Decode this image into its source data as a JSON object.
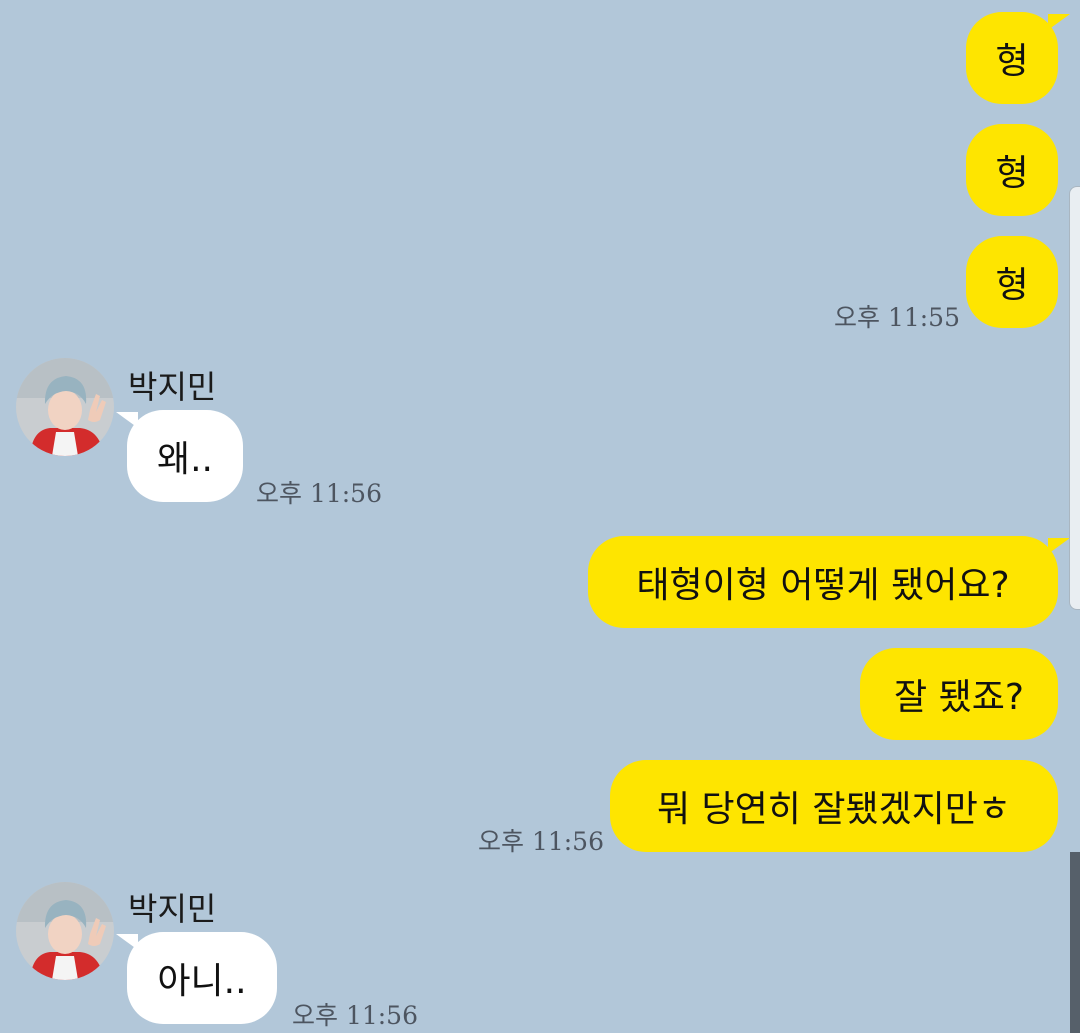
{
  "messages": {
    "m1": {
      "text": "형"
    },
    "m2": {
      "text": "형"
    },
    "m3": {
      "text": "형",
      "time": "오후 11:55"
    },
    "r1": {
      "sender": "박지민",
      "text": "왜..",
      "time": "오후 11:56"
    },
    "m4": {
      "text": "태형이형 어떻게 됐어요?"
    },
    "m5": {
      "text": "잘 됐죠?"
    },
    "m6": {
      "text": "뭐 당연히 잘됐겠지만ㅎ",
      "time": "오후 11:56"
    },
    "r2": {
      "sender": "박지민",
      "text": "아니..",
      "time": "오후 11:56"
    }
  },
  "icons": {
    "avatar": "profile-photo-avatar"
  },
  "colors": {
    "background": "#b2c7d9",
    "my_bubble": "#fee500",
    "their_bubble": "#ffffff"
  }
}
